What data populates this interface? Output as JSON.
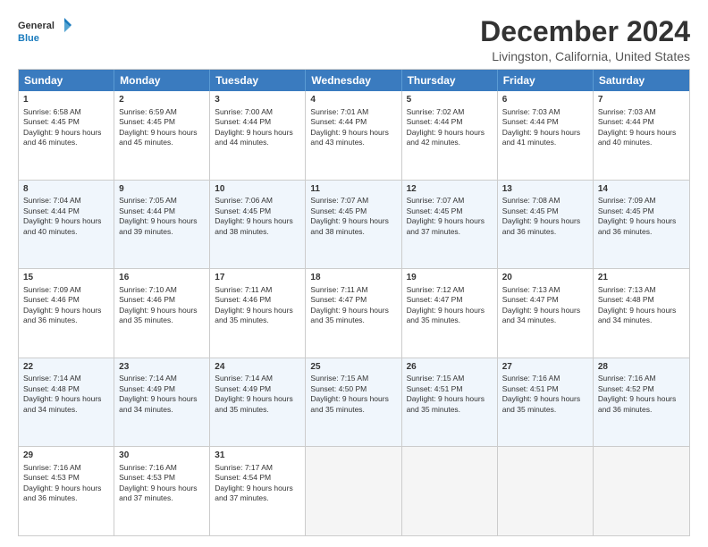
{
  "logo": {
    "line1": "General",
    "line2": "Blue"
  },
  "title": "December 2024",
  "subtitle": "Livingston, California, United States",
  "days": [
    "Sunday",
    "Monday",
    "Tuesday",
    "Wednesday",
    "Thursday",
    "Friday",
    "Saturday"
  ],
  "weeks": [
    [
      {
        "num": "1",
        "sunrise": "6:58 AM",
        "sunset": "4:45 PM",
        "daylight": "9 hours and 46 minutes."
      },
      {
        "num": "2",
        "sunrise": "6:59 AM",
        "sunset": "4:45 PM",
        "daylight": "9 hours and 45 minutes."
      },
      {
        "num": "3",
        "sunrise": "7:00 AM",
        "sunset": "4:44 PM",
        "daylight": "9 hours and 44 minutes."
      },
      {
        "num": "4",
        "sunrise": "7:01 AM",
        "sunset": "4:44 PM",
        "daylight": "9 hours and 43 minutes."
      },
      {
        "num": "5",
        "sunrise": "7:02 AM",
        "sunset": "4:44 PM",
        "daylight": "9 hours and 42 minutes."
      },
      {
        "num": "6",
        "sunrise": "7:03 AM",
        "sunset": "4:44 PM",
        "daylight": "9 hours and 41 minutes."
      },
      {
        "num": "7",
        "sunrise": "7:03 AM",
        "sunset": "4:44 PM",
        "daylight": "9 hours and 40 minutes."
      }
    ],
    [
      {
        "num": "8",
        "sunrise": "7:04 AM",
        "sunset": "4:44 PM",
        "daylight": "9 hours and 40 minutes."
      },
      {
        "num": "9",
        "sunrise": "7:05 AM",
        "sunset": "4:44 PM",
        "daylight": "9 hours and 39 minutes."
      },
      {
        "num": "10",
        "sunrise": "7:06 AM",
        "sunset": "4:45 PM",
        "daylight": "9 hours and 38 minutes."
      },
      {
        "num": "11",
        "sunrise": "7:07 AM",
        "sunset": "4:45 PM",
        "daylight": "9 hours and 38 minutes."
      },
      {
        "num": "12",
        "sunrise": "7:07 AM",
        "sunset": "4:45 PM",
        "daylight": "9 hours and 37 minutes."
      },
      {
        "num": "13",
        "sunrise": "7:08 AM",
        "sunset": "4:45 PM",
        "daylight": "9 hours and 36 minutes."
      },
      {
        "num": "14",
        "sunrise": "7:09 AM",
        "sunset": "4:45 PM",
        "daylight": "9 hours and 36 minutes."
      }
    ],
    [
      {
        "num": "15",
        "sunrise": "7:09 AM",
        "sunset": "4:46 PM",
        "daylight": "9 hours and 36 minutes."
      },
      {
        "num": "16",
        "sunrise": "7:10 AM",
        "sunset": "4:46 PM",
        "daylight": "9 hours and 35 minutes."
      },
      {
        "num": "17",
        "sunrise": "7:11 AM",
        "sunset": "4:46 PM",
        "daylight": "9 hours and 35 minutes."
      },
      {
        "num": "18",
        "sunrise": "7:11 AM",
        "sunset": "4:47 PM",
        "daylight": "9 hours and 35 minutes."
      },
      {
        "num": "19",
        "sunrise": "7:12 AM",
        "sunset": "4:47 PM",
        "daylight": "9 hours and 35 minutes."
      },
      {
        "num": "20",
        "sunrise": "7:13 AM",
        "sunset": "4:47 PM",
        "daylight": "9 hours and 34 minutes."
      },
      {
        "num": "21",
        "sunrise": "7:13 AM",
        "sunset": "4:48 PM",
        "daylight": "9 hours and 34 minutes."
      }
    ],
    [
      {
        "num": "22",
        "sunrise": "7:14 AM",
        "sunset": "4:48 PM",
        "daylight": "9 hours and 34 minutes."
      },
      {
        "num": "23",
        "sunrise": "7:14 AM",
        "sunset": "4:49 PM",
        "daylight": "9 hours and 34 minutes."
      },
      {
        "num": "24",
        "sunrise": "7:14 AM",
        "sunset": "4:49 PM",
        "daylight": "9 hours and 35 minutes."
      },
      {
        "num": "25",
        "sunrise": "7:15 AM",
        "sunset": "4:50 PM",
        "daylight": "9 hours and 35 minutes."
      },
      {
        "num": "26",
        "sunrise": "7:15 AM",
        "sunset": "4:51 PM",
        "daylight": "9 hours and 35 minutes."
      },
      {
        "num": "27",
        "sunrise": "7:16 AM",
        "sunset": "4:51 PM",
        "daylight": "9 hours and 35 minutes."
      },
      {
        "num": "28",
        "sunrise": "7:16 AM",
        "sunset": "4:52 PM",
        "daylight": "9 hours and 36 minutes."
      }
    ],
    [
      {
        "num": "29",
        "sunrise": "7:16 AM",
        "sunset": "4:53 PM",
        "daylight": "9 hours and 36 minutes."
      },
      {
        "num": "30",
        "sunrise": "7:16 AM",
        "sunset": "4:53 PM",
        "daylight": "9 hours and 37 minutes."
      },
      {
        "num": "31",
        "sunrise": "7:17 AM",
        "sunset": "4:54 PM",
        "daylight": "9 hours and 37 minutes."
      },
      null,
      null,
      null,
      null
    ]
  ]
}
